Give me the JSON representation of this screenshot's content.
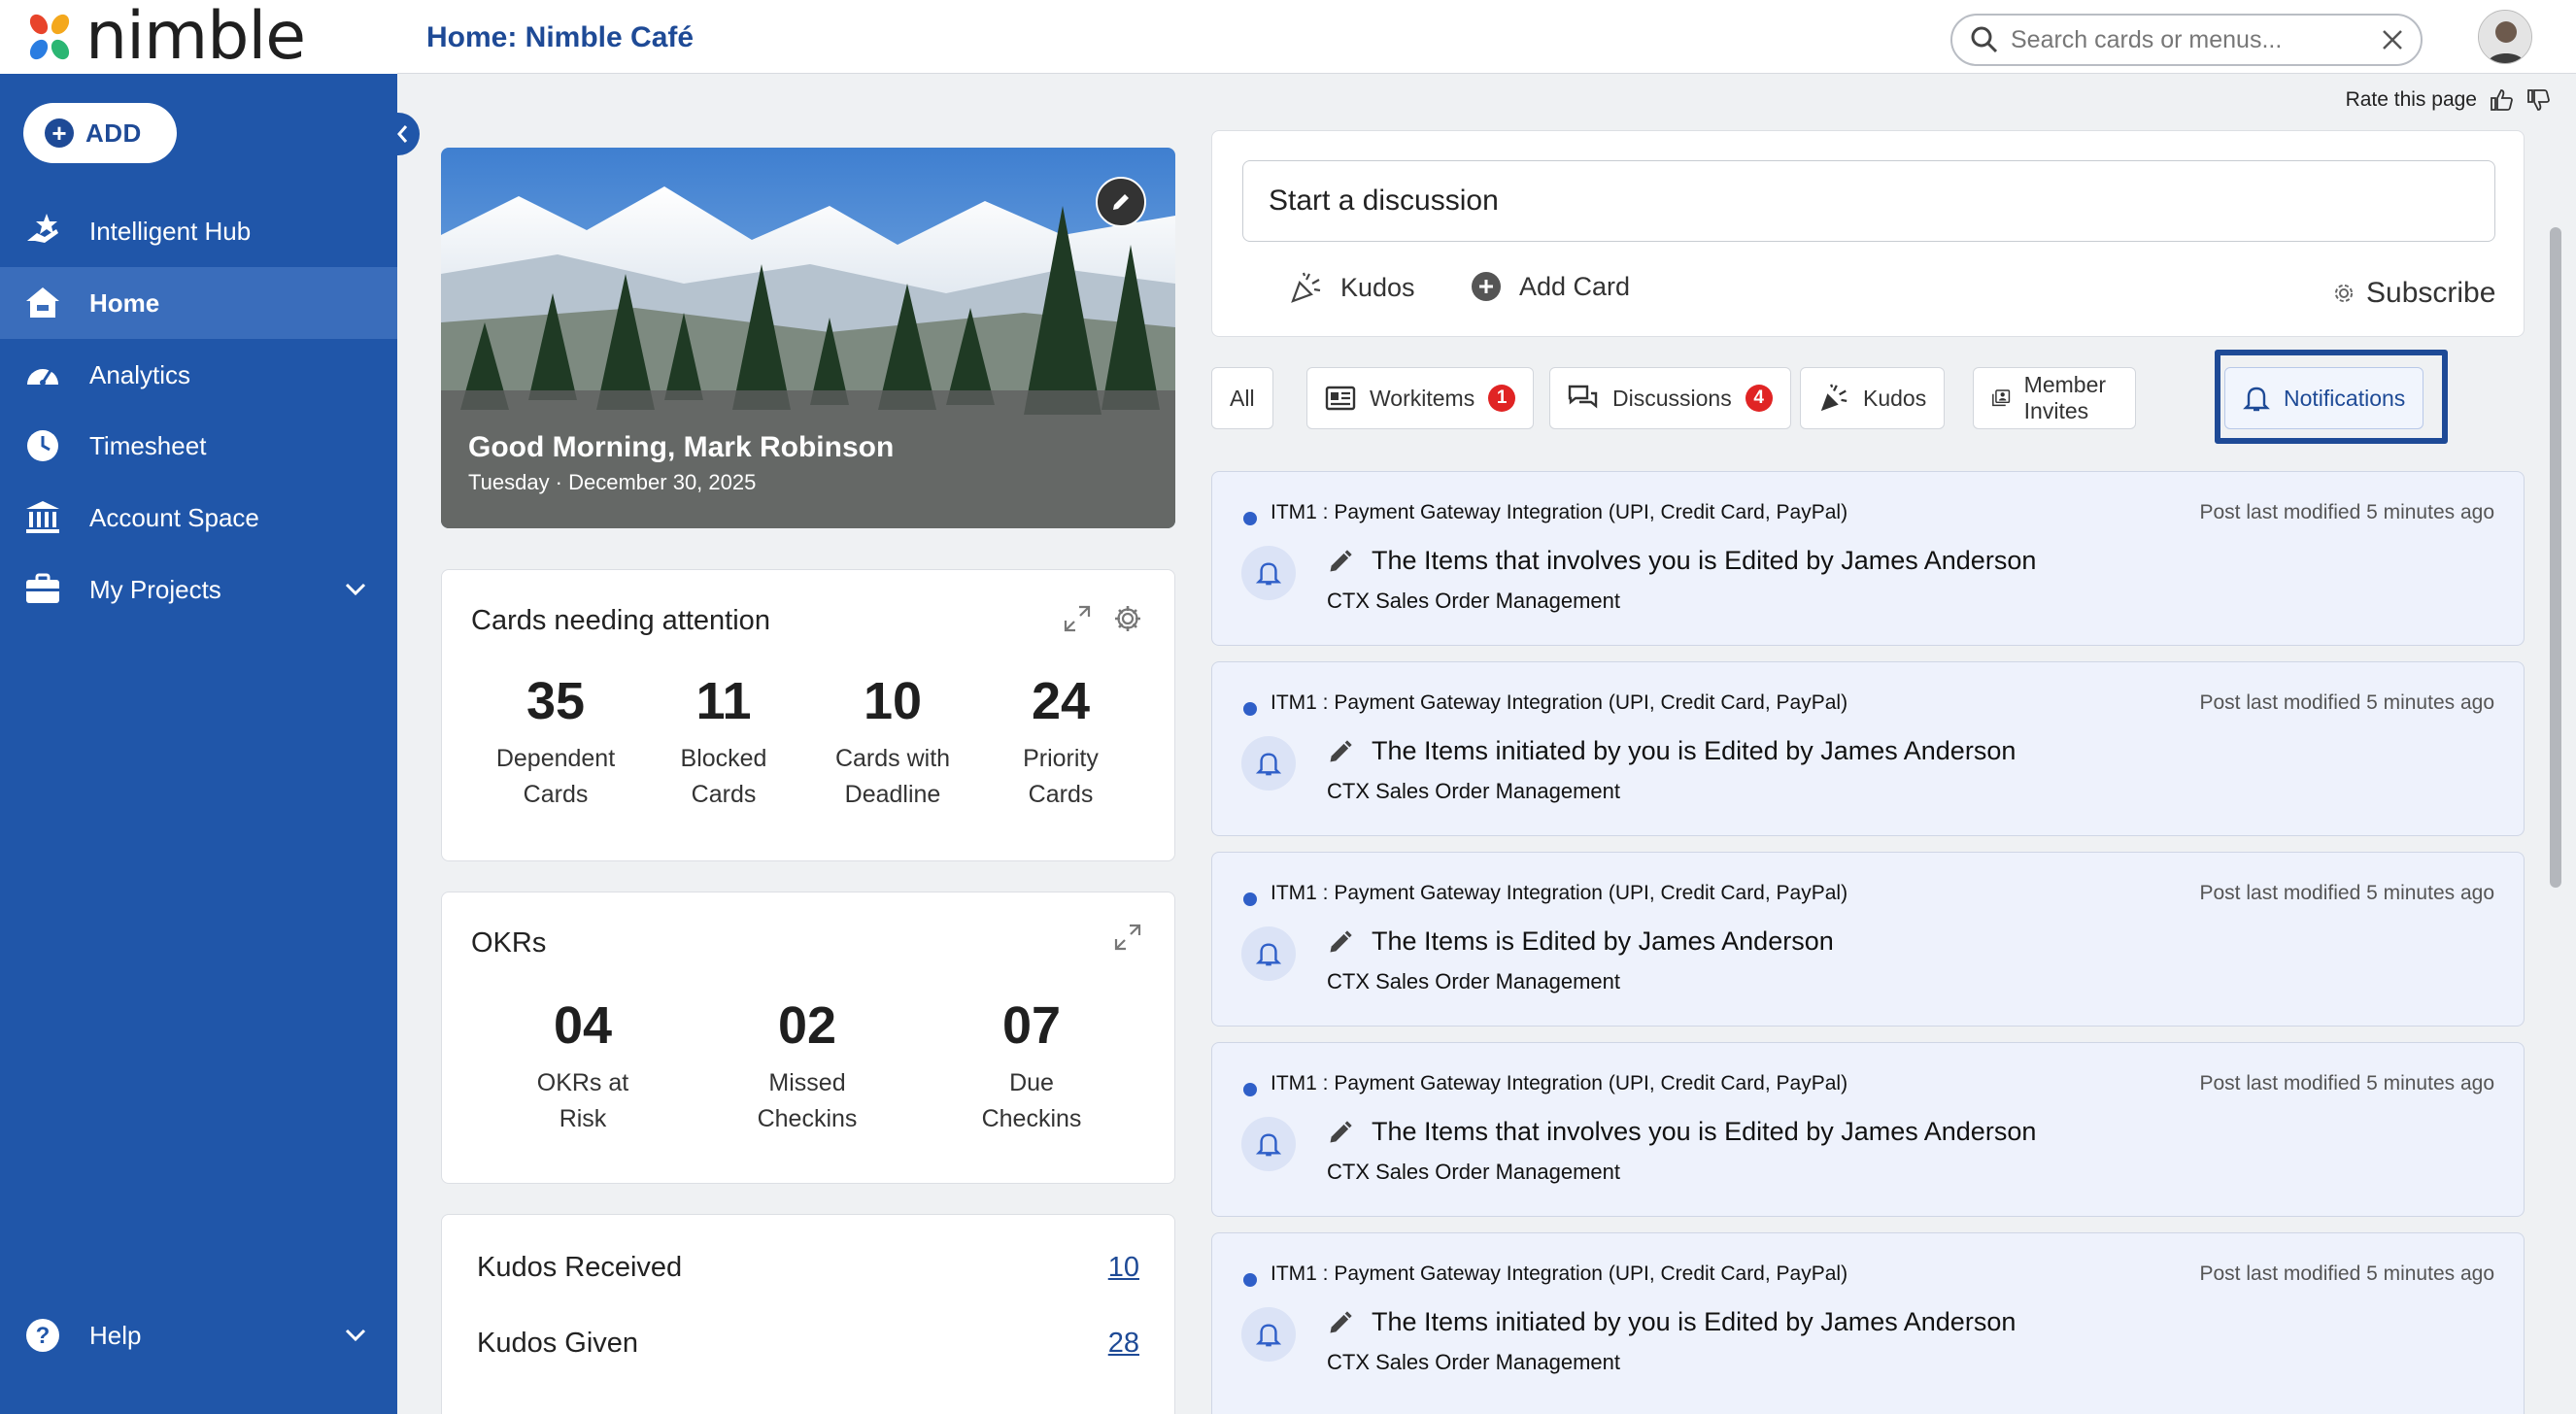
{
  "app": {
    "logo_text": "nimble",
    "page_title": "Home: Nimble Café"
  },
  "search": {
    "placeholder": "Search cards or menus..."
  },
  "rate_page": {
    "label": "Rate this page"
  },
  "sidebar": {
    "add_label": "ADD",
    "items": [
      {
        "label": "Intelligent Hub",
        "icon": "star-hand-icon"
      },
      {
        "label": "Home",
        "icon": "home-icon",
        "active": true
      },
      {
        "label": "Analytics",
        "icon": "speedometer-icon"
      },
      {
        "label": "Timesheet",
        "icon": "clock-icon"
      },
      {
        "label": "Account Space",
        "icon": "bank-icon"
      },
      {
        "label": "My Projects",
        "icon": "briefcase-icon",
        "expandable": true
      }
    ],
    "help_label": "Help"
  },
  "hero": {
    "greeting": "Good Morning, Mark Robinson",
    "date": "Tuesday · December 30, 2025"
  },
  "cards_attention": {
    "title": "Cards needing attention",
    "stats": [
      {
        "value": "35",
        "line1": "Dependent",
        "line2": "Cards"
      },
      {
        "value": "11",
        "line1": "Blocked",
        "line2": "Cards"
      },
      {
        "value": "10",
        "line1": "Cards with",
        "line2": "Deadline"
      },
      {
        "value": "24",
        "line1": "Priority",
        "line2": "Cards"
      }
    ]
  },
  "okrs": {
    "title": "OKRs",
    "stats": [
      {
        "value": "04",
        "line1": "OKRs at",
        "line2": "Risk"
      },
      {
        "value": "02",
        "line1": "Missed",
        "line2": "Checkins"
      },
      {
        "value": "07",
        "line1": "Due",
        "line2": "Checkins"
      }
    ]
  },
  "kudos_summary": {
    "received_label": "Kudos Received",
    "received_value": "10",
    "given_label": "Kudos Given",
    "given_value": "28"
  },
  "composer": {
    "placeholder": "Start a discussion",
    "kudos_label": "Kudos",
    "add_card_label": "Add Card",
    "subscribe_label": "Subscribe"
  },
  "tabs": [
    {
      "label": "All"
    },
    {
      "label": "Workitems",
      "badge": "1"
    },
    {
      "label": "Discussions",
      "badge": "4"
    },
    {
      "label": "Kudos"
    },
    {
      "label": "Member Invites"
    },
    {
      "label": "Notifications",
      "active": true
    }
  ],
  "notifications": [
    {
      "item": "ITM1 : Payment Gateway Integration (UPI, Credit Card, PayPal)",
      "time": "Post last modified 5 minutes ago",
      "message": "The Items that involves you is Edited by James Anderson",
      "project": "CTX Sales Order Management"
    },
    {
      "item": "ITM1 : Payment Gateway Integration (UPI, Credit Card, PayPal)",
      "time": "Post last modified 5 minutes ago",
      "message": "The Items initiated by you is Edited by James Anderson",
      "project": "CTX Sales Order Management"
    },
    {
      "item": "ITM1 : Payment Gateway Integration (UPI, Credit Card, PayPal)",
      "time": "Post last modified 5 minutes ago",
      "message": "The Items is Edited by James Anderson",
      "project": "CTX Sales Order Management"
    },
    {
      "item": "ITM1 : Payment Gateway Integration (UPI, Credit Card, PayPal)",
      "time": "Post last modified 5 minutes ago",
      "message": "The Items that involves you is Edited by James Anderson",
      "project": "CTX Sales Order Management"
    },
    {
      "item": "ITM1 : Payment Gateway Integration (UPI, Credit Card, PayPal)",
      "time": "Post last modified 5 minutes ago",
      "message": "The Items initiated by you is Edited by James Anderson",
      "project": "CTX Sales Order Management"
    }
  ],
  "colors": {
    "brand_blue": "#2056a9",
    "active_nav": "#3a6dbb",
    "badge_red": "#e02424",
    "notification_bg": "#eef2fc"
  }
}
